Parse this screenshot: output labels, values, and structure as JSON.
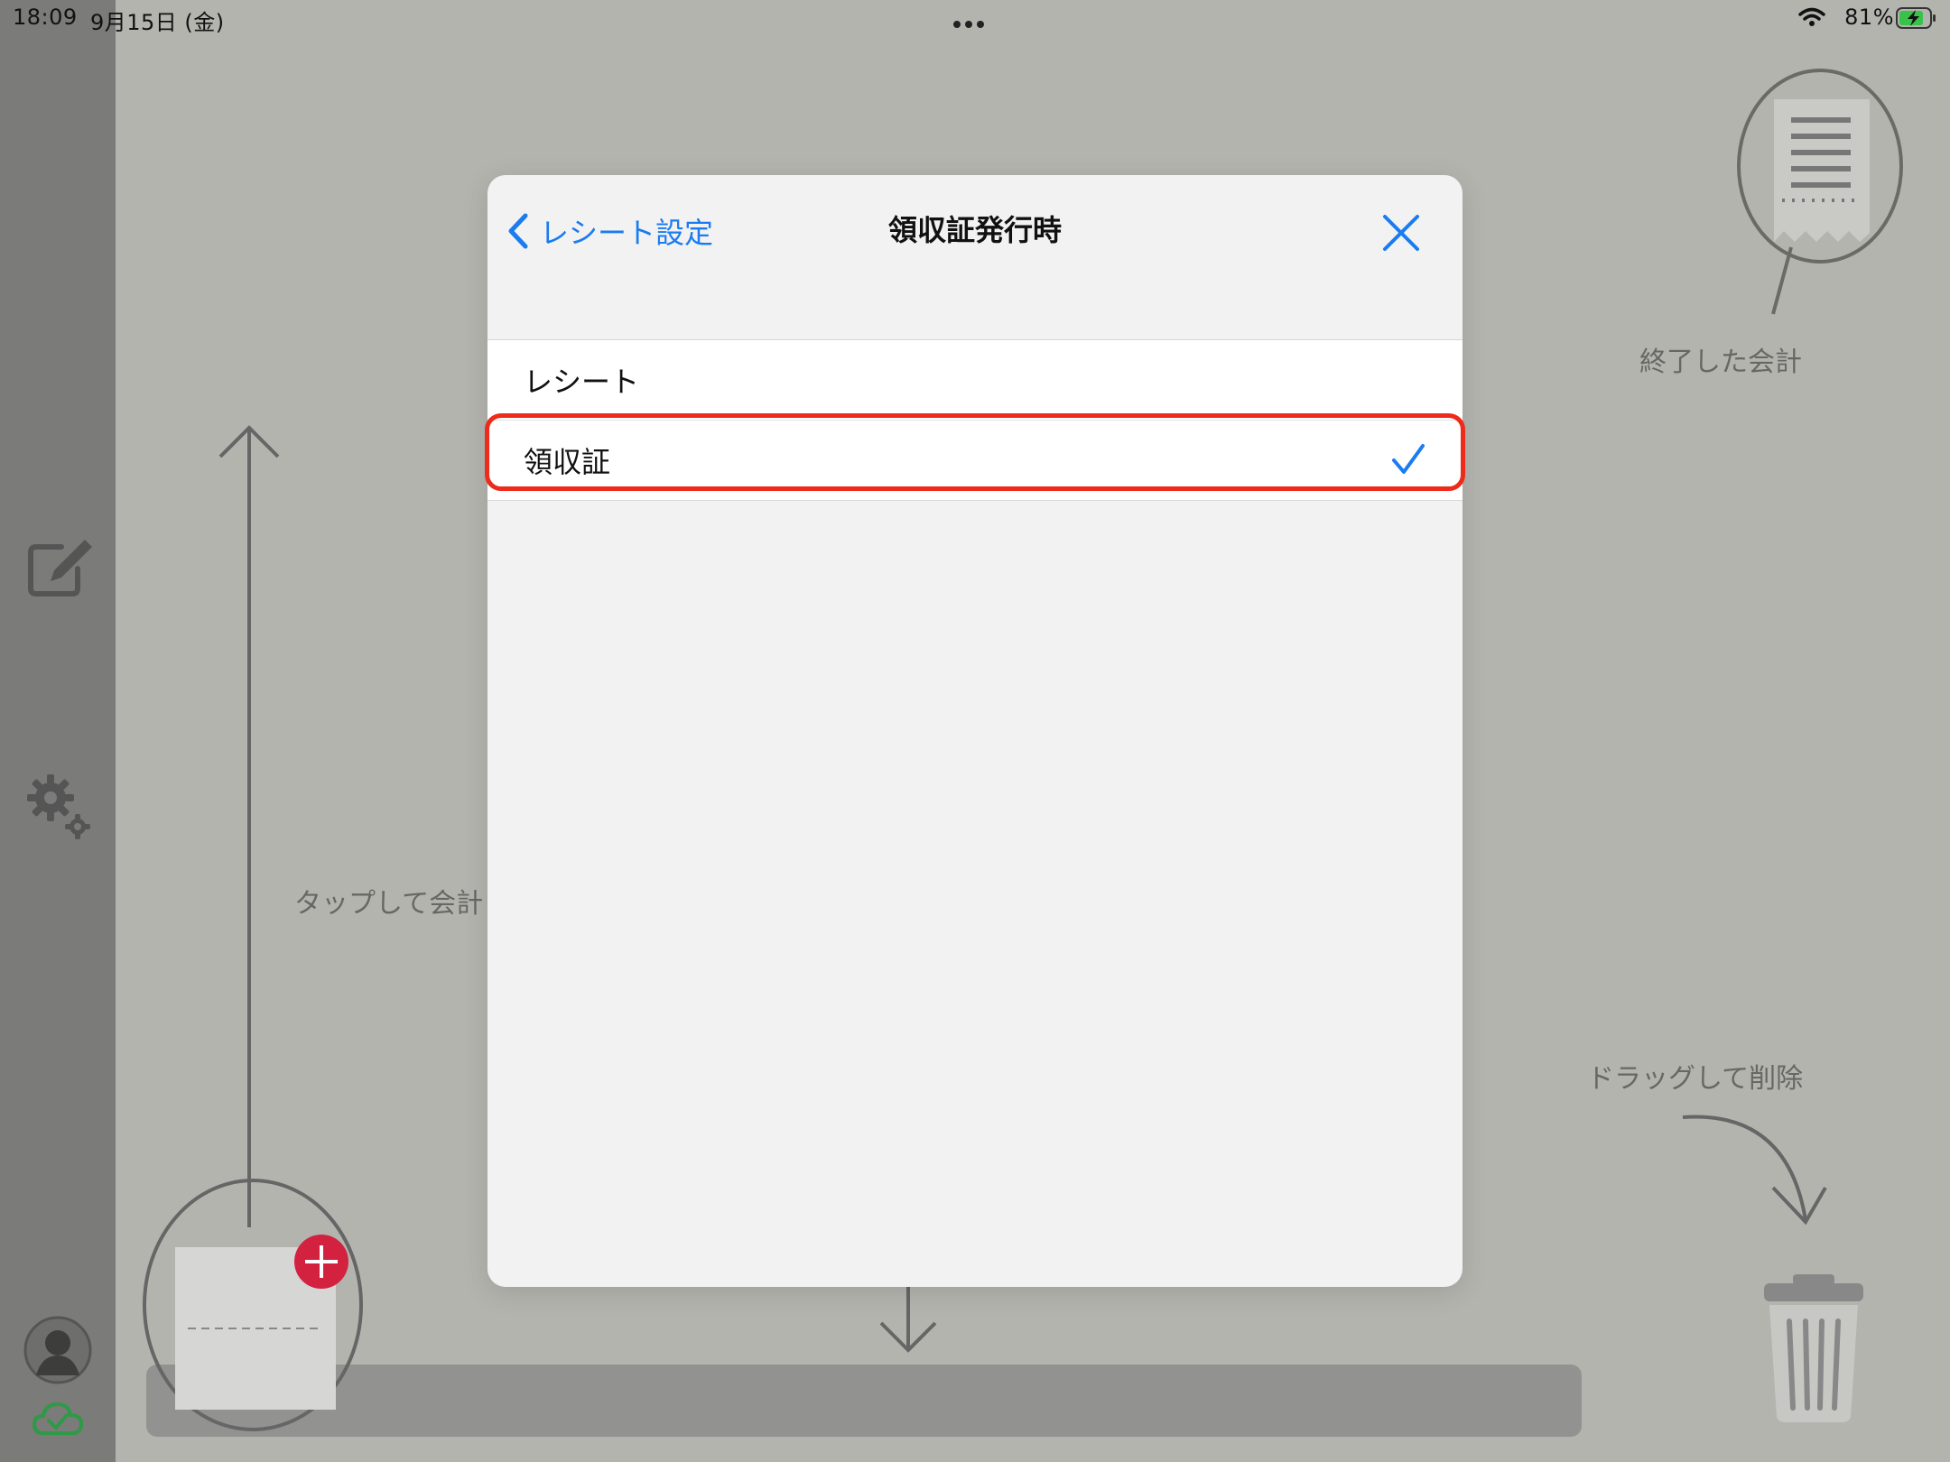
{
  "status_bar": {
    "time": "18:09",
    "date": "9月15日 (金)",
    "battery": "81%"
  },
  "background": {
    "finished_label": "終了した会計",
    "tap_label": "タップして会計",
    "drag_label": "ドラッグして削除"
  },
  "modal": {
    "back_label": "レシート設定",
    "title": "領収証発行時",
    "options": [
      {
        "label": "レシート",
        "selected": false
      },
      {
        "label": "領収証",
        "selected": true
      }
    ]
  },
  "colors": {
    "accent": "#1a7cf0",
    "highlight": "#ee2a1a",
    "add_badge": "#d3223f",
    "sync_ok": "#2e9a47"
  }
}
